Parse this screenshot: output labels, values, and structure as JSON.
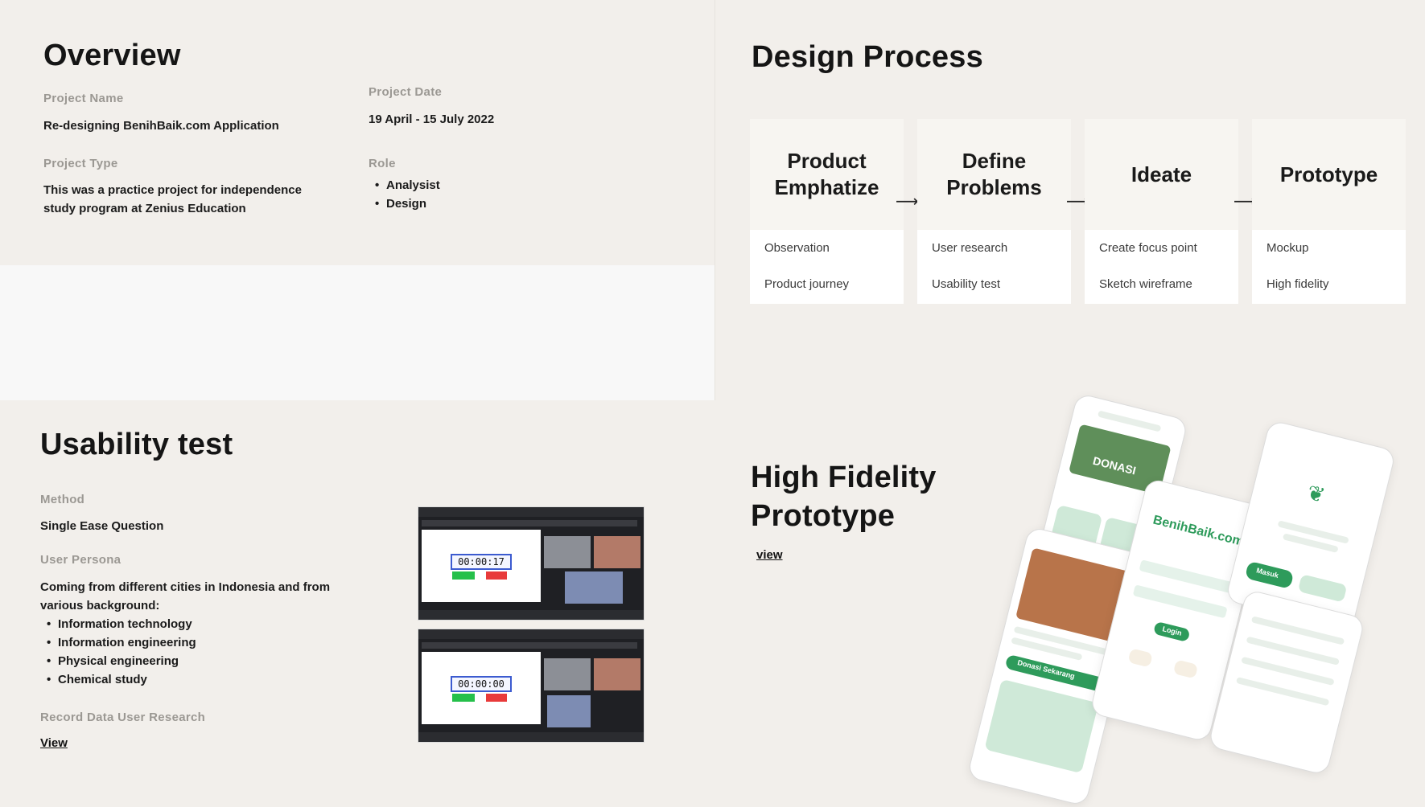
{
  "overview": {
    "title": "Overview",
    "project_name_label": "Project Name",
    "project_name": "Re-designing BenihBaik.com Application",
    "project_date_label": "Project Date",
    "project_date": "19 April - 15 July 2022",
    "project_type_label": "Project Type",
    "project_type_line1": "This was a practice project for independence",
    "project_type_line2": "study program at Zenius Education",
    "role_label": "Role",
    "roles": [
      "Analysist",
      "Design"
    ]
  },
  "design_process": {
    "title": "Design Process",
    "steps": [
      {
        "line1": "Product",
        "line2": "Emphatize",
        "items": [
          "Observation",
          "Product journey"
        ]
      },
      {
        "line1": "Define",
        "line2": "Problems",
        "items": [
          "User research",
          "Usability test"
        ]
      },
      {
        "line1": "Ideate",
        "line2": "",
        "items": [
          "Create focus point",
          "Sketch wireframe"
        ]
      },
      {
        "line1": "Prototype",
        "line2": "",
        "items": [
          "Mockup",
          "High fidelity"
        ]
      }
    ]
  },
  "usability": {
    "title": "Usability test",
    "method_label": "Method",
    "method": "Single Ease Question",
    "persona_label": "User Persona",
    "persona_line1": "Coming from different cities in Indonesia and from",
    "persona_line2": "various background:",
    "backgrounds": [
      "Information technology",
      "Information engineering",
      "Physical engineering",
      "Chemical study"
    ],
    "record_label": "Record Data User Research",
    "view_link": "View",
    "timers": [
      "00:00:17",
      "00:00:00"
    ]
  },
  "hifi": {
    "title_line1": "High Fidelity",
    "title_line2": "Prototype",
    "view_link": "view",
    "mockup_texts": {
      "donasi": "DONASI",
      "brand": "BenihBaik.com",
      "login": "Login",
      "masuk": "Masuk",
      "donasi_sekarang": "Donasi Sekarang"
    }
  },
  "colors": {
    "background": "#f2efeb",
    "accent_green": "#2e9b5b",
    "label_gray": "#9b9893"
  }
}
